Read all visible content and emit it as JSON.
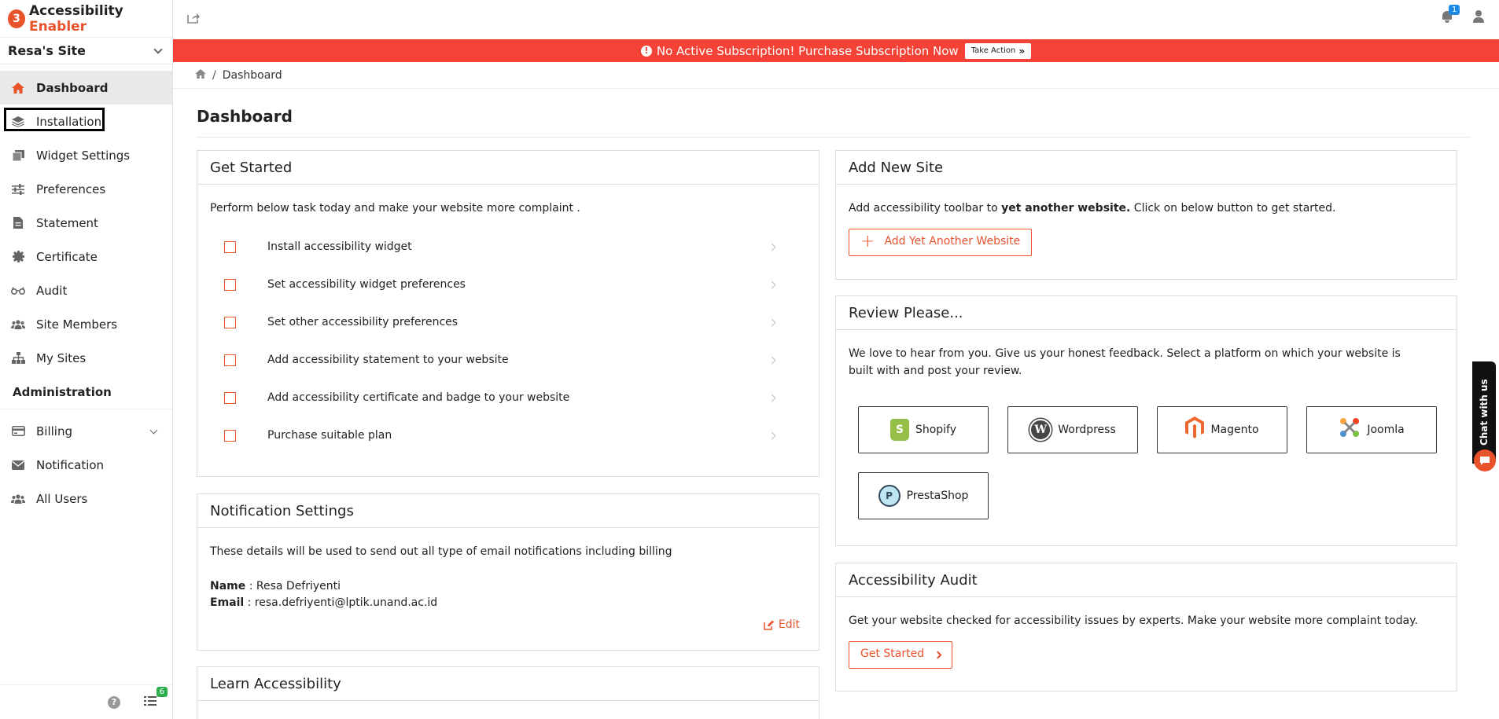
{
  "app": {
    "logo_mark": "3",
    "brand_part1": "Accessibility ",
    "brand_part2": "Enabler",
    "site_name": "Resa's Site"
  },
  "sidebar": {
    "items": [
      {
        "label": "Dashboard",
        "icon": "home-icon"
      },
      {
        "label": "Installation",
        "icon": "layers-icon"
      },
      {
        "label": "Widget Settings",
        "icon": "widget-icon"
      },
      {
        "label": "Preferences",
        "icon": "sliders-icon"
      },
      {
        "label": "Statement",
        "icon": "document-icon"
      },
      {
        "label": "Certificate",
        "icon": "certificate-icon"
      },
      {
        "label": "Audit",
        "icon": "glasses-icon"
      },
      {
        "label": "Site Members",
        "icon": "users-icon"
      },
      {
        "label": "My Sites",
        "icon": "sitemap-icon"
      }
    ],
    "admin_heading": "Administration",
    "admin_items": [
      {
        "label": "Billing",
        "icon": "credit-card-icon"
      },
      {
        "label": "Notification",
        "icon": "envelope-icon"
      },
      {
        "label": "All Users",
        "icon": "users-icon"
      }
    ],
    "tasks_count": "6"
  },
  "topbar": {
    "notification_count": "1"
  },
  "alert": {
    "text": "No Active Subscription! Purchase Subscription Now",
    "action_label": "Take Action"
  },
  "breadcrumb": {
    "separator": "/",
    "current": "Dashboard"
  },
  "page": {
    "title": "Dashboard"
  },
  "get_started": {
    "title": "Get Started",
    "intro": "Perform below task today and make your website more complaint .",
    "tasks": [
      "Install accessibility widget",
      "Set accessibility widget preferences",
      "Set other accessibility preferences",
      "Add accessibility statement to your website",
      "Add accessibility certificate and badge to your website",
      "Purchase suitable plan"
    ]
  },
  "notification_settings": {
    "title": "Notification Settings",
    "intro": "These details will be used to send out all type of email notifications including billing",
    "name_label": "Name",
    "name_value": "Resa Defriyenti",
    "email_label": "Email",
    "email_value": "resa.defriyenti@lptik.unand.ac.id",
    "edit_label": "Edit"
  },
  "learn": {
    "title": "Learn Accessibility"
  },
  "add_site": {
    "title": "Add New Site",
    "text_before": "Add accessibility toolbar to ",
    "text_bold": "yet another website.",
    "text_after": " Click on below button to get started.",
    "button_label": "Add Yet Another Website"
  },
  "review": {
    "title": "Review Please...",
    "text": "We love to hear from you. Give us your honest feedback. Select a platform on which your website is built with and post your review.",
    "platforms": [
      {
        "label": "Shopify",
        "color": "#95bf47"
      },
      {
        "label": "Wordpress",
        "color": "#464646"
      },
      {
        "label": "Magento",
        "color": "#ee672f"
      },
      {
        "label": "Joomla",
        "color": "#5091cd"
      },
      {
        "label": "PrestaShop",
        "color": "#df0067"
      }
    ]
  },
  "audit": {
    "title": "Accessibility Audit",
    "text": "Get your website checked for accessibility issues by experts. Make your website more complaint today.",
    "button_label": "Get Started"
  },
  "chat": {
    "label": "Chat with us"
  },
  "colors": {
    "accent": "#e8532c",
    "alert": "#f44336"
  }
}
